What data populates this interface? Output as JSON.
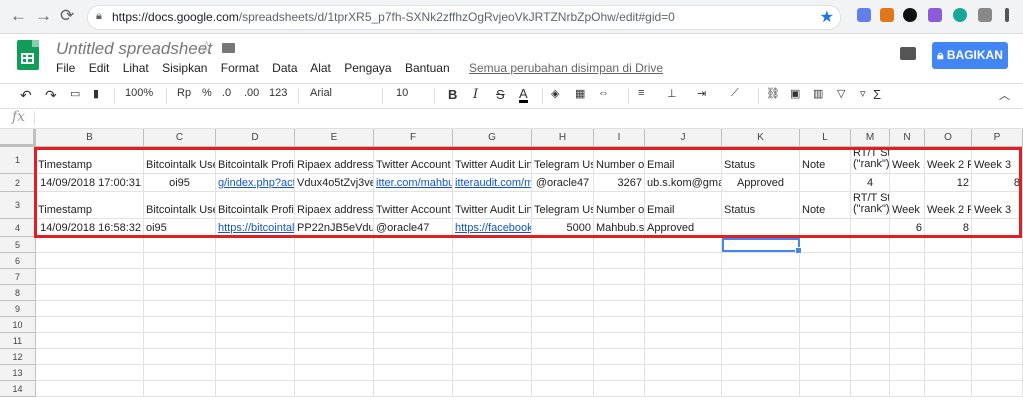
{
  "browser": {
    "back": "←",
    "forward": "→",
    "reload": "⟳",
    "url_host": "https://docs.google.com",
    "url_path": "/spreadsheets/d/1tprXR5_p7fh-SXNk2zffhzOgRvjeoVkJRTZNrbZpOhw/edit#gid=0"
  },
  "doc": {
    "title": "Untitled spreadsheet",
    "menus": [
      "File",
      "Edit",
      "Lihat",
      "Sisipkan",
      "Format",
      "Data",
      "Alat",
      "Pengaya",
      "Bantuan"
    ],
    "saved_status": "Semua perubahan disimpan di Drive",
    "share_label": "BAGIKAN"
  },
  "toolbar": {
    "zoom": "100%",
    "currency": "Rp",
    "percent": "%",
    "dec_less": ".0",
    "dec_more": ".00",
    "format_more": "123",
    "font": "Arial",
    "font_size": "10",
    "bold": "B",
    "italic": "I",
    "strike": "S",
    "text_color": "A",
    "functions": "Σ"
  },
  "formula_bar": {
    "fx": "fx",
    "value": ""
  },
  "sheet": {
    "columns": [
      "B",
      "C",
      "D",
      "E",
      "F",
      "G",
      "H",
      "I",
      "J",
      "K",
      "L",
      "M",
      "N",
      "O",
      "P"
    ],
    "row_numbers": [
      "1",
      "2",
      "3",
      "4",
      "5",
      "6",
      "7",
      "8",
      "9",
      "10",
      "11",
      "12",
      "13",
      "14"
    ],
    "row1": [
      "Timestamp",
      "Bitcointalk User",
      "Bitcointalk Profile",
      "Ripaex address",
      "Twitter Account U",
      "Twitter Audit Link",
      "Telegram Use",
      "Number of",
      "Email",
      "Status",
      "Note",
      "RT/T Sta\n(\"rank\")",
      "Week 1",
      "Week 2 R",
      "Week 3"
    ],
    "row2": [
      "14/09/2018 17:00:31",
      "oi95",
      "g/index.php?action",
      "Vdux4o5tZvj3veiT",
      "itter.com/mahbub",
      "itteraudit.com/ma",
      "@oracle47",
      "3267",
      "ub.s.kom@gmai",
      "Approved",
      "",
      "4",
      "",
      "12",
      "8"
    ],
    "row3": [
      "Timestamp",
      "Bitcointalk User",
      "Bitcointalk Profile",
      "Ripaex address",
      "Twitter Account U",
      "Twitter Audit Link",
      "Telegram Use",
      "Number of",
      "Email",
      "Status",
      "Note",
      "RT/T Sta\n(\"rank\")",
      "Week 1",
      "Week 2 R",
      "Week 3"
    ],
    "row4": [
      "14/09/2018 16:58:32",
      "oi95",
      "https://bitcointalk",
      "PP22nJB5eVdux",
      "@oracle47",
      "https://facebook.c",
      "5000",
      "Mahbub.s.",
      "Approved",
      "",
      "",
      "",
      "6",
      "8",
      ""
    ]
  },
  "colors": {
    "accent": "#4285f4",
    "highlight_box": "#e02020",
    "sheets_green": "#0f9d58",
    "link": "#1155cc"
  }
}
